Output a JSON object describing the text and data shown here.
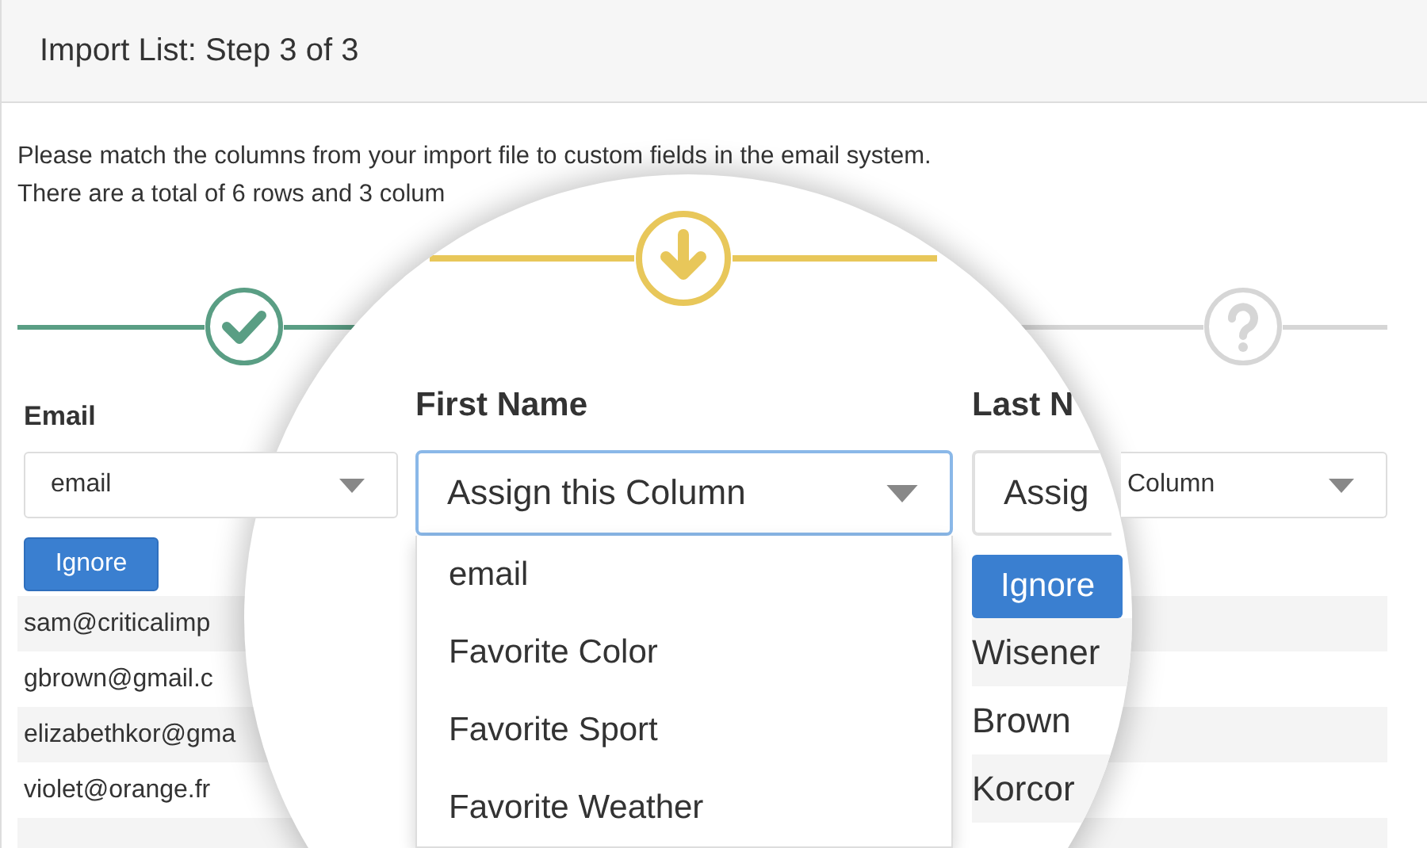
{
  "header": {
    "title": "Import List: Step 3 of 3"
  },
  "intro": {
    "line_1": "Please match the columns from your import file to custom fields in the email system.",
    "line_2": "There are a total of 6 rows and 3 colum"
  },
  "steps": [
    {
      "kind": "done"
    },
    {
      "kind": "current"
    },
    {
      "kind": "pending"
    }
  ],
  "columns": [
    {
      "header": "Email",
      "select": "email",
      "button": "Ignore",
      "cells": [
        "sam@criticalimp",
        "gbrown@gmail.c",
        "elizabethkor@gma",
        "violet@orange.fr"
      ]
    },
    {
      "select": "Column"
    }
  ],
  "magnifier": {
    "column": {
      "header": "First Name",
      "select": "Assign this Column",
      "focused": true,
      "options": [
        "email",
        "Favorite Color",
        "Favorite Sport",
        "Favorite Weather"
      ]
    },
    "next_column": {
      "header": "Last N",
      "select": "Assig",
      "button": "Ignore",
      "cells": [
        "Wisener",
        "Brown",
        "Korcor"
      ]
    }
  }
}
